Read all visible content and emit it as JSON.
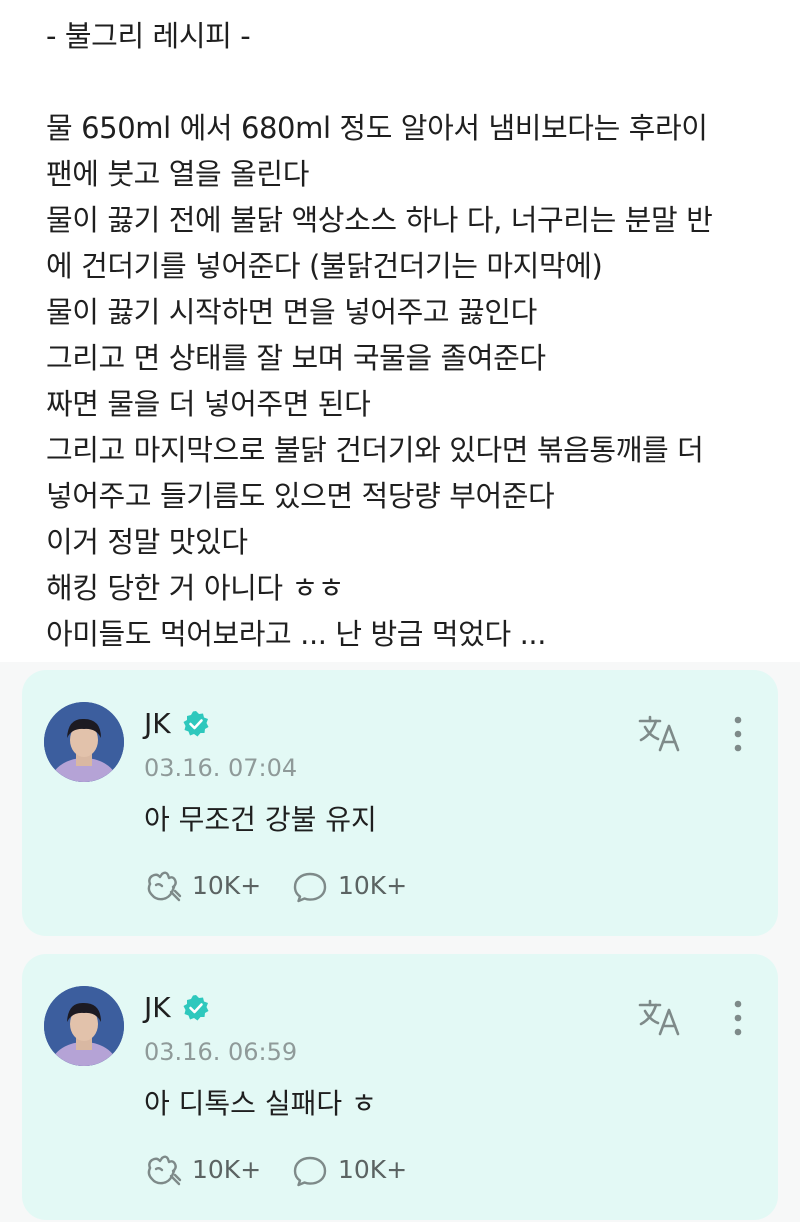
{
  "post": {
    "lines": [
      "- 불그리 레시피 -",
      "물 650ml 에서 680ml 정도 알아서 냄비보다는 후라이",
      "팬에 붓고 열을 올린다",
      "물이 끓기 전에 불닭 액상소스 하나 다, 너구리는 분말 반",
      "에 건더기를 넣어준다 (불닭건더기는 마지막에)",
      "물이 끓기 시작하면 면을 넣어주고 끓인다",
      "그리고 면 상태를 잘 보며 국물을 졸여준다",
      "짜면 물을 더 넣어주면 된다",
      "그리고 마지막으로 불닭 건더기와 있다면 볶음통깨를 더",
      "넣어주고 들기름도 있으면 적당량 부어준다",
      "이거 정말 맛있다",
      "해킹 당한 거 아니다 ㅎㅎ",
      "아미들도 먹어보라고 ... 난 방금 먹었다 ..."
    ]
  },
  "comments": [
    {
      "author": "JK",
      "timestamp": "03.16. 07:04",
      "text": "아 무조건 강불 유지",
      "like_count": "10K+",
      "reply_count": "10K+"
    },
    {
      "author": "JK",
      "timestamp": "03.16. 06:59",
      "text": "아 디톡스 실패다 ㅎ",
      "like_count": "10K+",
      "reply_count": "10K+"
    }
  ],
  "icons": {
    "verified": "verified-badge-icon",
    "translate": "translate-icon",
    "more": "more-vertical-icon",
    "like": "like-hand-icon",
    "reply": "reply-bubble-icon"
  },
  "colors": {
    "card_background": "#e3f9f5",
    "verified": "#2ec8bd",
    "timestamp": "#8f9a99",
    "icon": "#7e8a89"
  }
}
